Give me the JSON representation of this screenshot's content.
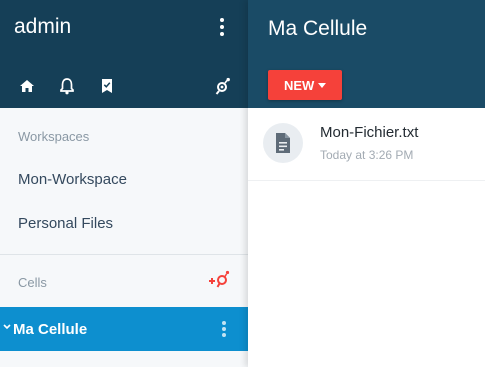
{
  "sidebar": {
    "user_name": "admin",
    "sections": {
      "workspaces_label": "Workspaces",
      "cells_label": "Cells"
    },
    "workspaces": [
      {
        "label": "Mon-Workspace"
      },
      {
        "label": "Personal Files"
      }
    ],
    "cells": [
      {
        "label": "Ma Cellule",
        "active": true
      }
    ],
    "icons": [
      "home-icon",
      "bell-icon",
      "bookmark-icon",
      "share-icon",
      "add-cell-icon",
      "more-vert-icon",
      "chevron-down-icon"
    ]
  },
  "main": {
    "title": "Ma Cellule",
    "new_button_label": "NEW",
    "files": [
      {
        "name": "Mon-Fichier.txt",
        "modified": "Today at 3:26 PM",
        "icon": "text-file-icon"
      }
    ]
  },
  "colors": {
    "sidebar_header": "#153f57",
    "main_header": "#1a4b66",
    "accent": "#0d8fcf",
    "new_button": "#f5413a"
  }
}
